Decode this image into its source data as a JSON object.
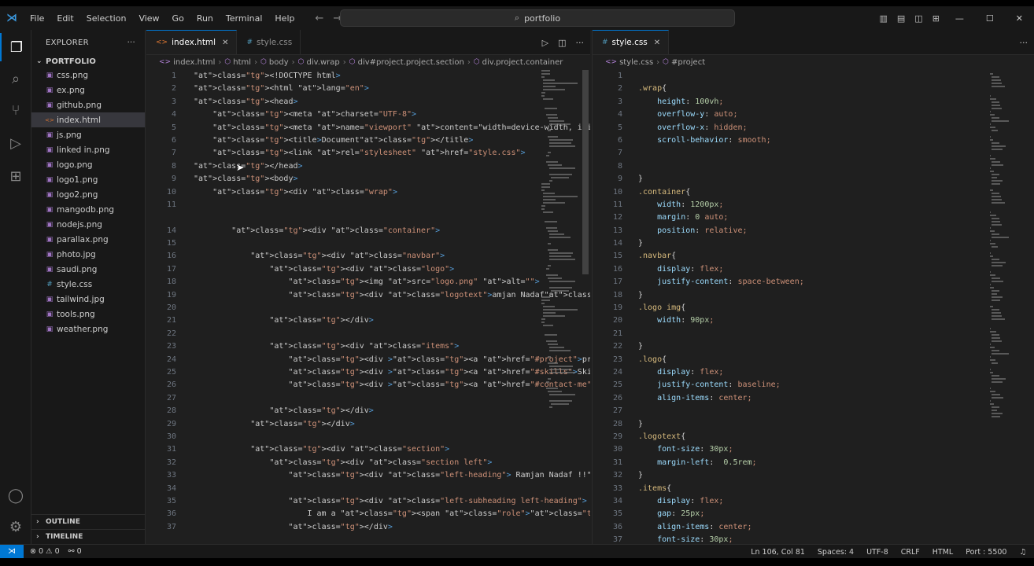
{
  "titlebar": {
    "menu": [
      "File",
      "Edit",
      "Selection",
      "View",
      "Go",
      "Run",
      "Terminal",
      "Help"
    ],
    "search_text": "portfolio"
  },
  "sidebar": {
    "title": "EXPLORER",
    "more": "···",
    "folder": "PORTFOLIO",
    "files": [
      {
        "name": "css.png",
        "type": "img"
      },
      {
        "name": "ex.png",
        "type": "img"
      },
      {
        "name": "github.png",
        "type": "img"
      },
      {
        "name": "index.html",
        "type": "html",
        "active": true
      },
      {
        "name": "js.png",
        "type": "img"
      },
      {
        "name": "linked in.png",
        "type": "img"
      },
      {
        "name": "logo.png",
        "type": "img"
      },
      {
        "name": "logo1.png",
        "type": "img"
      },
      {
        "name": "logo2.png",
        "type": "img"
      },
      {
        "name": "mangodb.png",
        "type": "img"
      },
      {
        "name": "nodejs.png",
        "type": "img"
      },
      {
        "name": "parallax.png",
        "type": "img"
      },
      {
        "name": "photo.jpg",
        "type": "img"
      },
      {
        "name": "saudi.png",
        "type": "img"
      },
      {
        "name": "style.css",
        "type": "css"
      },
      {
        "name": "tailwind.jpg",
        "type": "img"
      },
      {
        "name": "tools.png",
        "type": "img"
      },
      {
        "name": "weather.png",
        "type": "img"
      }
    ],
    "outline": "OUTLINE",
    "timeline": "TIMELINE"
  },
  "editor_left": {
    "tabs": [
      "index.html",
      "style.css"
    ],
    "breadcrumb": [
      "index.html",
      "html",
      "body",
      "div.wrap",
      "div#project.project.section",
      "div.project.container"
    ],
    "line_numbers": [
      "1",
      "2",
      "3",
      "4",
      "5",
      "6",
      "7",
      "8",
      "9",
      "10",
      "11",
      "",
      "14",
      "15",
      "16",
      "17",
      "18",
      "19",
      "20",
      "21",
      "22",
      "23",
      "24",
      "25",
      "26",
      "27",
      "28",
      "29",
      "30",
      "31",
      "32",
      "33",
      "34",
      "35",
      "36",
      "37"
    ],
    "lines": [
      "<!DOCTYPE html>",
      "<html lang=\"en\">",
      "<head>",
      "    <meta charset=\"UTF-8\">",
      "    <meta name=\"viewport\" content=\"width=device-width, initial-scal",
      "    <title>Document</title>",
      "    <link rel=\"stylesheet\" href=\"style.css\">",
      "</head>",
      "<body>",
      "    <div class=\"wrap\">",
      "",
      "",
      "        <div class=\"container\">",
      "",
      "            <div class=\"navbar\">",
      "                <div class=\"logo\">",
      "                    <img src=\"logo.png\" alt=\"\">",
      "                    <div class=\"logotext\">amjan Nadaf</div>",
      "",
      "                </div>",
      "",
      "                <div class=\"items\">",
      "                    <div ><a href=\"#project\">projects</a></div>",
      "                    <div ><a href=\"#skills\">Skills</a></div>",
      "                    <div ><a href=\"#contact-me\">Contact Me</a></div",
      "",
      "                </div>",
      "            </div>",
      "",
      "            <div class=\"section\">",
      "                <div class=\"section left\">",
      "                    <div class=\"left-heading\"> Ramjan Nadaf !!</div",
      "",
      "                    <div class=\"left-subheading left-heading\">",
      "                        I am a <span class=\"role\"></span>",
      "                    </div>"
    ]
  },
  "editor_right": {
    "tab": "style.css",
    "breadcrumb": [
      "style.css",
      "#project"
    ],
    "line_numbers": [
      "1",
      "2",
      "3",
      "4",
      "5",
      "6",
      "7",
      "8",
      "9",
      "10",
      "11",
      "12",
      "13",
      "14",
      "15",
      "16",
      "17",
      "18",
      "19",
      "20",
      "21",
      "22",
      "23",
      "24",
      "25",
      "26",
      "27",
      "28",
      "29",
      "30",
      "31",
      "32",
      "33",
      "34",
      "35",
      "36",
      "37"
    ],
    "lines": [
      "",
      ".wrap{",
      "    height: 100vh;",
      "    overflow-y: auto;",
      "    overflow-x: hidden;",
      "    scroll-behavior: smooth;",
      "",
      "",
      "}",
      ".container{",
      "    width: 1200px;",
      "    margin: 0 auto;",
      "    position: relative;",
      "}",
      ".navbar{",
      "    display: flex;",
      "    justify-content: space-between;",
      "}",
      ".logo img{",
      "    width: 90px;",
      "",
      "}",
      ".logo{",
      "    display: flex;",
      "    justify-content: baseline;",
      "    align-items: center;",
      "",
      "}",
      ".logotext{",
      "    font-size: 30px;",
      "    margin-left:  0.5rem;",
      "}",
      ".items{",
      "    display: flex;",
      "    gap: 25px;",
      "    align-items: center;",
      "    font-size: 30px;"
    ]
  },
  "statusbar": {
    "errors": "⊗ 0 ⚠ 0",
    "ports_left": "⚯ 0",
    "position": "Ln 106, Col 81",
    "spaces": "Spaces: 4",
    "encoding": "UTF-8",
    "eol": "CRLF",
    "language": "HTML",
    "port": "Port : 5500"
  },
  "colors": {
    "accent": "#0078d4",
    "background": "#1f1f1f",
    "tag": "#569cd6",
    "attribute": "#9cdcfe",
    "string": "#ce9178",
    "selector": "#d7ba7d"
  }
}
